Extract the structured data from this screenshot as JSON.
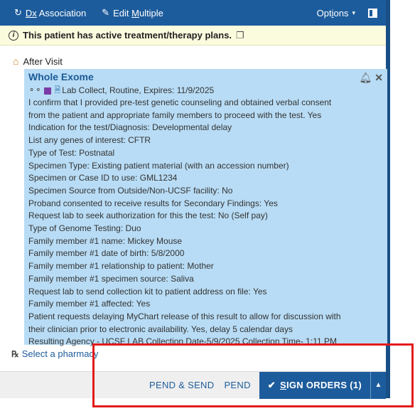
{
  "toolbar": {
    "dx_association": "Dx Association",
    "dx_letters": "Dx",
    "dx_rest": " Association",
    "edit_multiple_prefix": "Edit ",
    "edit_multiple_u": "M",
    "edit_multiple_rest": "ultiple",
    "options_prefix": "Opt",
    "options_u": "i",
    "options_rest": "ons"
  },
  "alert": {
    "text": "This patient has active treatment/therapy plans."
  },
  "section": {
    "after_visit": "After Visit"
  },
  "order": {
    "title": "Whole Exome",
    "summary": "Lab Collect, Routine, Expires: 11/9/2025",
    "details": [
      "I confirm that I provided pre-test genetic counseling and obtained verbal consent",
      "from the patient and appropriate family members to proceed with the test. Yes",
      "Indication for the test/Diagnosis: Developmental delay",
      "List any genes of interest: CFTR",
      "Type of Test: Postnatal",
      "Specimen Type: Existing patient material (with an accession number)",
      "Specimen or Case ID to use: GML1234",
      "Specimen Source from Outside/Non-UCSF facility: No",
      "Proband consented to receive results for Secondary Findings: Yes",
      "Request lab to seek authorization for this the test: No (Self pay)",
      "Type of Genome Testing: Duo",
      "Family member #1 name: Mickey Mouse",
      "Family member #1 date of birth: 5/8/2000",
      "Family member #1 relationship to patient: Mother",
      "Family member #1 specimen source: Saliva",
      "Request lab to send collection kit to patient address on file: Yes",
      "Family member #1 affected: Yes",
      "Patient requests delaying MyChart release of this result to allow for discussion with",
      "their clinician prior to electronic availability. Yes, delay 5 calendar days",
      "Resulting Agency - UCSF LAB Collection Date-5/9/2025 Collection Time- 1:11 PM"
    ]
  },
  "pharmacy": {
    "label": "Select a pharmacy"
  },
  "footer": {
    "pend_send": "PEND & SEND",
    "pend": "PEND",
    "sign_u": "S",
    "sign_rest": "IGN ORDERS (1)"
  },
  "colors": {
    "toolbar": "#1d5c9c",
    "order_bg": "#b8dcf5",
    "alert_bg": "#fbfbde",
    "highlight": "#e31b1b"
  }
}
